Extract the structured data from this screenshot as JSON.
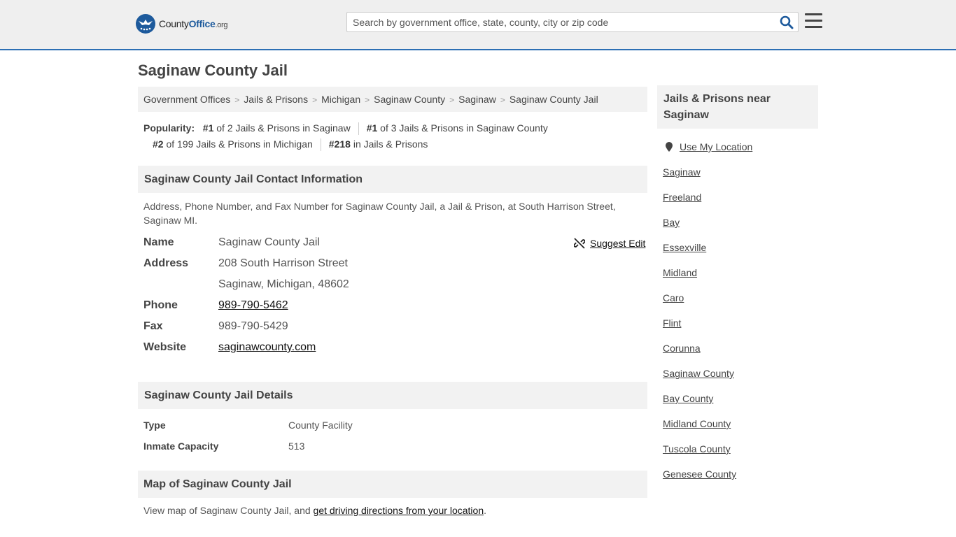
{
  "header": {
    "logo_county": "County",
    "logo_office": "Office",
    "logo_tld": ".org",
    "search_placeholder": "Search by government office, state, county, city or zip code"
  },
  "page_title": "Saginaw County Jail",
  "breadcrumb": [
    "Government Offices",
    "Jails & Prisons",
    "Michigan",
    "Saginaw County",
    "Saginaw",
    "Saginaw County Jail"
  ],
  "popularity": {
    "label": "Popularity:",
    "items": [
      {
        "rank": "#1",
        "text": " of 2 Jails & Prisons in Saginaw"
      },
      {
        "rank": "#1",
        "text": " of 3 Jails & Prisons in Saginaw County"
      },
      {
        "rank": "#2",
        "text": " of 199 Jails & Prisons in Michigan"
      },
      {
        "rank": "#218",
        "text": " in Jails & Prisons"
      }
    ]
  },
  "contact": {
    "heading": "Saginaw County Jail Contact Information",
    "description": "Address, Phone Number, and Fax Number for Saginaw County Jail, a Jail & Prison, at South Harrison Street, Saginaw MI.",
    "suggest_edit": "Suggest Edit",
    "name_label": "Name",
    "name": "Saginaw County Jail",
    "address_label": "Address",
    "address_line1": "208 South Harrison Street",
    "address_line2": "Saginaw, Michigan, 48602",
    "phone_label": "Phone",
    "phone": "989-790-5462",
    "fax_label": "Fax",
    "fax": "989-790-5429",
    "website_label": "Website",
    "website": "saginawcounty.com"
  },
  "details": {
    "heading": "Saginaw County Jail Details",
    "type_label": "Type",
    "type": "County Facility",
    "capacity_label": "Inmate Capacity",
    "capacity": "513"
  },
  "map": {
    "heading": "Map of Saginaw County Jail",
    "text": "View map of Saginaw County Jail, and ",
    "link": "get driving directions from your location",
    "tail": "."
  },
  "sidebar": {
    "heading": "Jails & Prisons near Saginaw",
    "use_location": "Use My Location",
    "items": [
      "Saginaw",
      "Freeland",
      "Bay",
      "Essexville",
      "Midland",
      "Caro",
      "Flint",
      "Corunna",
      "Saginaw County",
      "Bay County",
      "Midland County",
      "Tuscola County",
      "Genesee County"
    ]
  },
  "colors": {
    "accent": "#2d6fb4",
    "search_icon": "#1d5a9c"
  }
}
